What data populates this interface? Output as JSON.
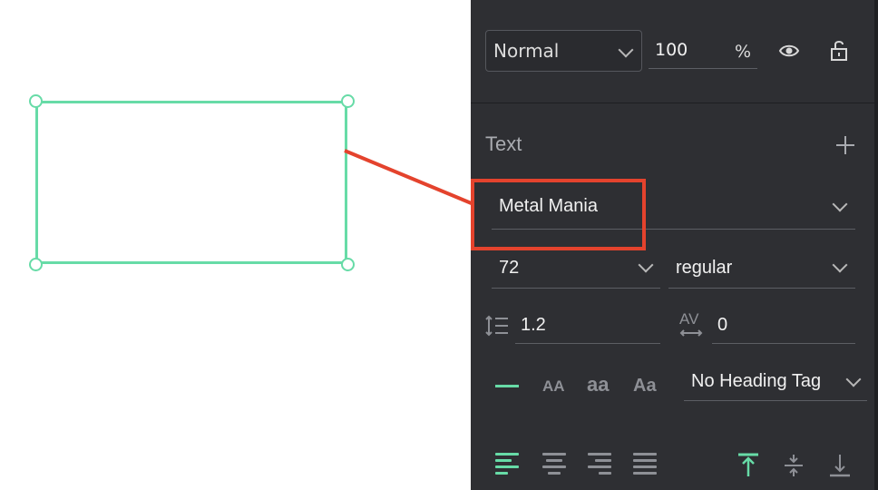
{
  "layer": {
    "blend_mode": "Normal",
    "opacity_value": "100",
    "opacity_unit": "%"
  },
  "text_section": {
    "title": "Text",
    "font_family": "Metal Mania",
    "font_size": "72",
    "font_weight": "regular",
    "line_height": "1.2",
    "letter_spacing_icon": "AV",
    "letter_spacing": "0",
    "case_upper": "AA",
    "case_lower": "aa",
    "case_title": "Aa",
    "heading_tag": "No Heading Tag"
  },
  "colors": {
    "selection": "#67dba7",
    "highlight": "#e4432d",
    "panel_bg": "#2e2f33"
  }
}
